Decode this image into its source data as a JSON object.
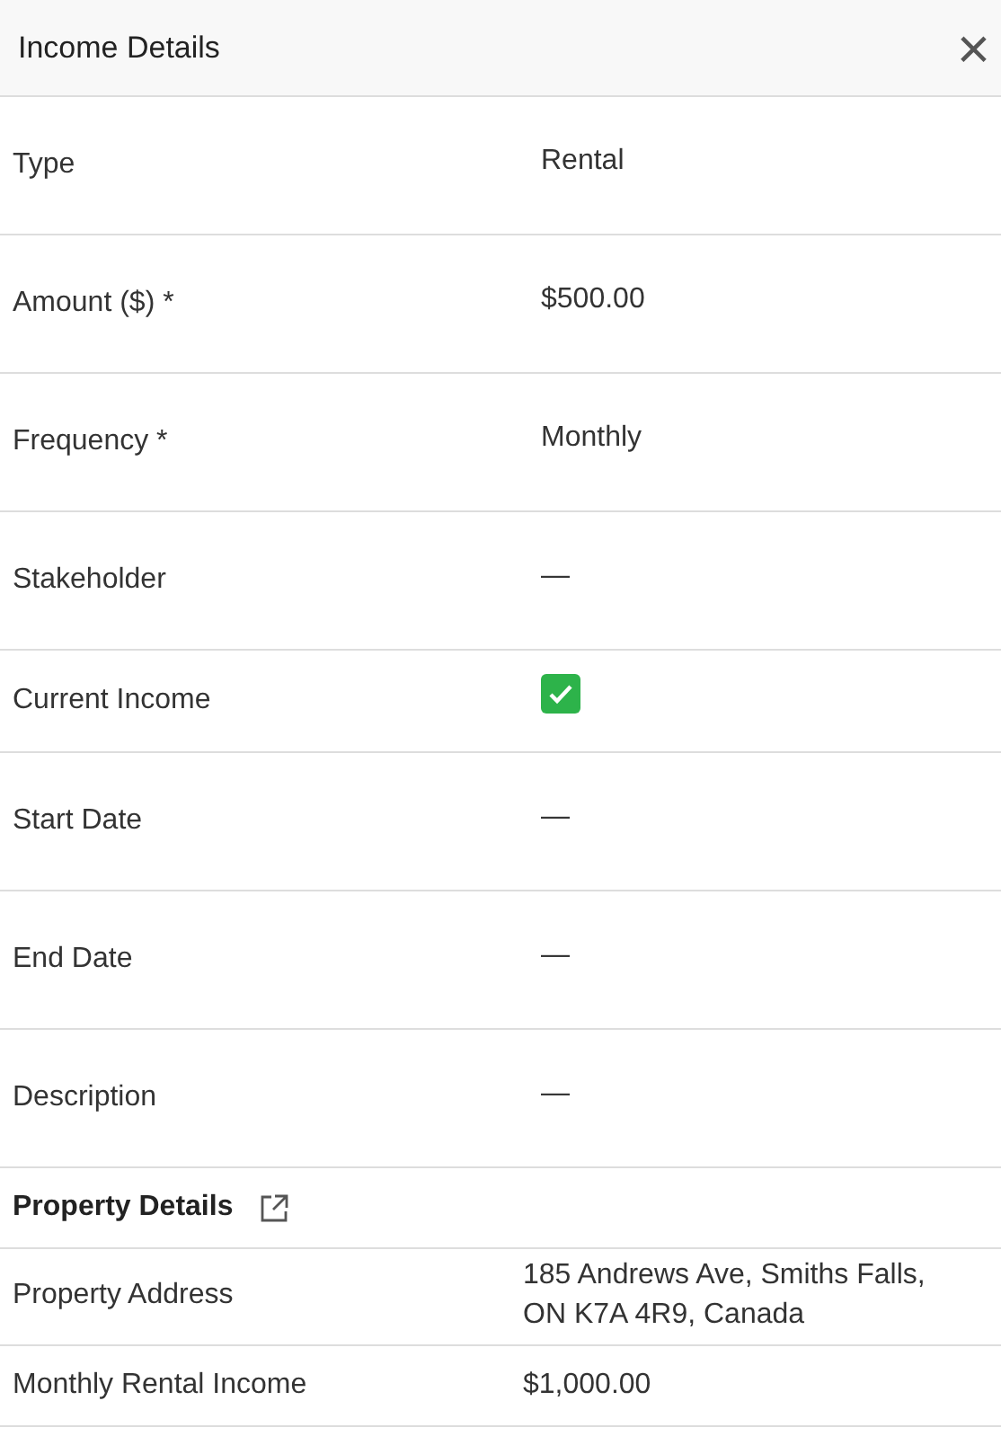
{
  "header": {
    "title": "Income Details",
    "close": "×"
  },
  "fields": [
    {
      "label": "Type",
      "kind": "text",
      "value": "Rental"
    },
    {
      "label": "Amount ($) *",
      "kind": "text",
      "value": "$500.00"
    },
    {
      "label": "Frequency *",
      "kind": "text",
      "value": "Monthly"
    },
    {
      "label": "Stakeholder",
      "kind": "text",
      "value": "—"
    },
    {
      "label": "Current Income",
      "kind": "checkbox",
      "checked": true
    },
    {
      "label": "Start Date",
      "kind": "text",
      "value": "—"
    },
    {
      "label": "End Date",
      "kind": "text",
      "value": "—"
    },
    {
      "label": "Description",
      "kind": "text",
      "value": "—"
    }
  ],
  "property_section": {
    "title": "Property Details",
    "fields": [
      {
        "label": "Property Address",
        "value": "185 Andrews Ave, Smiths Falls, ON K7A 4R9, Canada"
      },
      {
        "label": "Monthly Rental Income",
        "value": "$1,000.00"
      }
    ]
  }
}
